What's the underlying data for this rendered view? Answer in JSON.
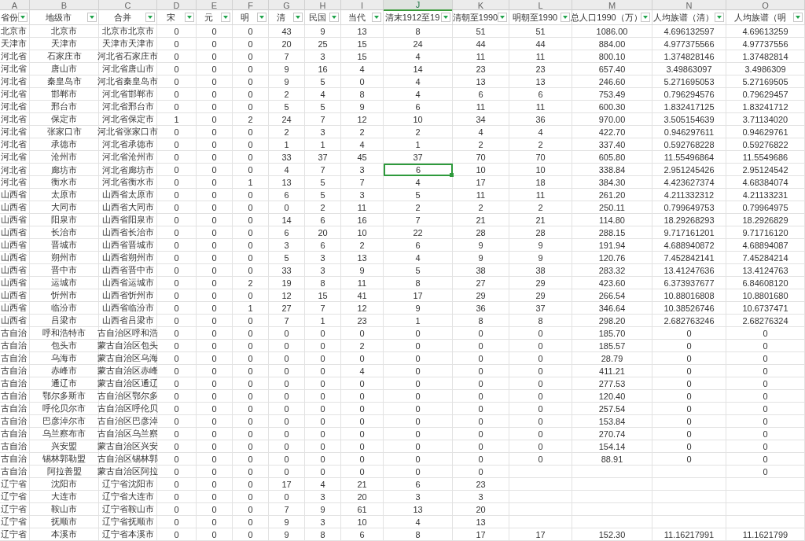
{
  "column_letters": [
    {
      "label": "A",
      "selected": false
    },
    {
      "label": "B",
      "selected": false
    },
    {
      "label": "C",
      "selected": false
    },
    {
      "label": "D",
      "selected": false
    },
    {
      "label": "E",
      "selected": false
    },
    {
      "label": "F",
      "selected": false
    },
    {
      "label": "G",
      "selected": false
    },
    {
      "label": "H",
      "selected": false
    },
    {
      "label": "I",
      "selected": false
    },
    {
      "label": "J",
      "selected": true
    },
    {
      "label": "K",
      "selected": false
    },
    {
      "label": "L",
      "selected": false
    },
    {
      "label": "M",
      "selected": false
    },
    {
      "label": "N",
      "selected": false
    },
    {
      "label": "O",
      "selected": false
    }
  ],
  "header": [
    "省份",
    "地级市",
    "合并",
    "宋",
    "元",
    "明",
    "清",
    "民国",
    "当代",
    "清末1912至19",
    "清朝至1990",
    "明朝至1990",
    "总人口1990（万）",
    "人均族谱（清）",
    "人均族谱（明"
  ],
  "rows": [
    {
      "selected": false,
      "cells": [
        "北京市",
        "北京市",
        "北京市北京市",
        "0",
        "0",
        "0",
        "43",
        "9",
        "13",
        "8",
        "51",
        "51",
        "1086.00",
        "4.696132597",
        "4.69613259"
      ]
    },
    {
      "selected": false,
      "cells": [
        "天津市",
        "天津市",
        "天津市天津市",
        "0",
        "0",
        "0",
        "20",
        "25",
        "15",
        "24",
        "44",
        "44",
        "884.00",
        "4.977375566",
        "4.97737556"
      ]
    },
    {
      "selected": false,
      "cells": [
        "河北省",
        "石家庄市",
        "河北省石家庄市",
        "0",
        "0",
        "0",
        "7",
        "3",
        "15",
        "4",
        "11",
        "11",
        "800.10",
        "1.374828146",
        "1.37482814"
      ]
    },
    {
      "selected": false,
      "cells": [
        "河北省",
        "唐山市",
        "河北省唐山市",
        "0",
        "0",
        "0",
        "9",
        "16",
        "4",
        "14",
        "23",
        "23",
        "657.40",
        "3.49863097",
        "3.4986309"
      ]
    },
    {
      "selected": false,
      "cells": [
        "河北省",
        "秦皇岛市",
        "河北省秦皇岛市",
        "0",
        "0",
        "0",
        "9",
        "5",
        "0",
        "4",
        "13",
        "13",
        "246.60",
        "5.271695053",
        "5.27169505"
      ]
    },
    {
      "selected": false,
      "cells": [
        "河北省",
        "邯郸市",
        "河北省邯郸市",
        "0",
        "0",
        "0",
        "2",
        "4",
        "8",
        "4",
        "6",
        "6",
        "753.49",
        "0.796294576",
        "0.79629457"
      ]
    },
    {
      "selected": false,
      "cells": [
        "河北省",
        "邢台市",
        "河北省邢台市",
        "0",
        "0",
        "0",
        "5",
        "5",
        "9",
        "6",
        "11",
        "11",
        "600.30",
        "1.832417125",
        "1.83241712"
      ]
    },
    {
      "selected": false,
      "cells": [
        "河北省",
        "保定市",
        "河北省保定市",
        "1",
        "0",
        "2",
        "24",
        "7",
        "12",
        "10",
        "34",
        "36",
        "970.00",
        "3.505154639",
        "3.71134020"
      ]
    },
    {
      "selected": false,
      "cells": [
        "河北省",
        "张家口市",
        "河北省张家口市",
        "0",
        "0",
        "0",
        "2",
        "3",
        "2",
        "2",
        "4",
        "4",
        "422.70",
        "0.946297611",
        "0.94629761"
      ]
    },
    {
      "selected": false,
      "cells": [
        "河北省",
        "承德市",
        "河北省承德市",
        "0",
        "0",
        "0",
        "1",
        "1",
        "4",
        "1",
        "2",
        "2",
        "337.40",
        "0.592768228",
        "0.59276822"
      ]
    },
    {
      "selected": false,
      "cells": [
        "河北省",
        "沧州市",
        "河北省沧州市",
        "0",
        "0",
        "0",
        "33",
        "37",
        "45",
        "37",
        "70",
        "70",
        "605.80",
        "11.55496864",
        "11.5549686"
      ]
    },
    {
      "selected": true,
      "cells": [
        "河北省",
        "廊坊市",
        "河北省廊坊市",
        "0",
        "0",
        "0",
        "4",
        "7",
        "3",
        "6",
        "10",
        "10",
        "338.84",
        "2.951245426",
        "2.95124542"
      ]
    },
    {
      "selected": false,
      "cells": [
        "河北省",
        "衡水市",
        "河北省衡水市",
        "0",
        "0",
        "1",
        "13",
        "5",
        "7",
        "4",
        "17",
        "18",
        "384.30",
        "4.423627374",
        "4.68384074"
      ]
    },
    {
      "selected": false,
      "cells": [
        "山西省",
        "太原市",
        "山西省太原市",
        "0",
        "0",
        "0",
        "6",
        "5",
        "3",
        "5",
        "11",
        "11",
        "261.20",
        "4.211332312",
        "4.21133231"
      ]
    },
    {
      "selected": false,
      "cells": [
        "山西省",
        "大同市",
        "山西省大同市",
        "0",
        "0",
        "0",
        "0",
        "2",
        "11",
        "2",
        "2",
        "2",
        "250.11",
        "0.799649753",
        "0.79964975"
      ]
    },
    {
      "selected": false,
      "cells": [
        "山西省",
        "阳泉市",
        "山西省阳泉市",
        "0",
        "0",
        "0",
        "14",
        "6",
        "16",
        "7",
        "21",
        "21",
        "114.80",
        "18.29268293",
        "18.2926829"
      ]
    },
    {
      "selected": false,
      "cells": [
        "山西省",
        "长治市",
        "山西省长治市",
        "0",
        "0",
        "0",
        "6",
        "20",
        "10",
        "22",
        "28",
        "28",
        "288.15",
        "9.717161201",
        "9.71716120"
      ]
    },
    {
      "selected": false,
      "cells": [
        "山西省",
        "晋城市",
        "山西省晋城市",
        "0",
        "0",
        "0",
        "3",
        "6",
        "2",
        "6",
        "9",
        "9",
        "191.94",
        "4.688940872",
        "4.68894087"
      ]
    },
    {
      "selected": false,
      "cells": [
        "山西省",
        "朔州市",
        "山西省朔州市",
        "0",
        "0",
        "0",
        "5",
        "3",
        "13",
        "4",
        "9",
        "9",
        "120.76",
        "7.452842141",
        "7.45284214"
      ]
    },
    {
      "selected": false,
      "cells": [
        "山西省",
        "晋中市",
        "山西省晋中市",
        "0",
        "0",
        "0",
        "33",
        "3",
        "9",
        "5",
        "38",
        "38",
        "283.32",
        "13.41247636",
        "13.4124763"
      ]
    },
    {
      "selected": false,
      "cells": [
        "山西省",
        "运城市",
        "山西省运城市",
        "0",
        "0",
        "2",
        "19",
        "8",
        "11",
        "8",
        "27",
        "29",
        "423.60",
        "6.373937677",
        "6.84608120"
      ]
    },
    {
      "selected": false,
      "cells": [
        "山西省",
        "忻州市",
        "山西省忻州市",
        "0",
        "0",
        "0",
        "12",
        "15",
        "41",
        "17",
        "29",
        "29",
        "266.54",
        "10.88016808",
        "10.8801680"
      ]
    },
    {
      "selected": false,
      "cells": [
        "山西省",
        "临汾市",
        "山西省临汾市",
        "0",
        "0",
        "1",
        "27",
        "7",
        "12",
        "9",
        "36",
        "37",
        "346.64",
        "10.38526746",
        "10.6737471"
      ]
    },
    {
      "selected": false,
      "cells": [
        "山西省",
        "吕梁市",
        "山西省吕梁市",
        "0",
        "0",
        "0",
        "7",
        "1",
        "23",
        "1",
        "8",
        "8",
        "298.20",
        "2.682763246",
        "2.68276324"
      ]
    },
    {
      "selected": false,
      "cells": [
        "古自治",
        "呼和浩特市",
        "古自治区呼和浩",
        "0",
        "0",
        "0",
        "0",
        "0",
        "0",
        "0",
        "0",
        "0",
        "185.70",
        "0",
        "0"
      ]
    },
    {
      "selected": false,
      "cells": [
        "古自治",
        "包头市",
        "蒙古自治区包头",
        "0",
        "0",
        "0",
        "0",
        "0",
        "2",
        "0",
        "0",
        "0",
        "185.57",
        "0",
        "0"
      ]
    },
    {
      "selected": false,
      "cells": [
        "古自治",
        "乌海市",
        "蒙古自治区乌海",
        "0",
        "0",
        "0",
        "0",
        "0",
        "0",
        "0",
        "0",
        "0",
        "28.79",
        "0",
        "0"
      ]
    },
    {
      "selected": false,
      "cells": [
        "古自治",
        "赤峰市",
        "蒙古自治区赤峰",
        "0",
        "0",
        "0",
        "0",
        "0",
        "4",
        "0",
        "0",
        "0",
        "411.21",
        "0",
        "0"
      ]
    },
    {
      "selected": false,
      "cells": [
        "古自治",
        "通辽市",
        "蒙古自治区通辽",
        "0",
        "0",
        "0",
        "0",
        "0",
        "0",
        "0",
        "0",
        "0",
        "277.53",
        "0",
        "0"
      ]
    },
    {
      "selected": false,
      "cells": [
        "古自治",
        "鄂尔多斯市",
        "古自治区鄂尔多",
        "0",
        "0",
        "0",
        "0",
        "0",
        "0",
        "0",
        "0",
        "0",
        "120.40",
        "0",
        "0"
      ]
    },
    {
      "selected": false,
      "cells": [
        "古自治",
        "呼伦贝尔市",
        "古自治区呼伦贝",
        "0",
        "0",
        "0",
        "0",
        "0",
        "0",
        "0",
        "0",
        "0",
        "257.54",
        "0",
        "0"
      ]
    },
    {
      "selected": false,
      "cells": [
        "古自治",
        "巴彦淖尔市",
        "古自治区巴彦淖",
        "0",
        "0",
        "0",
        "0",
        "0",
        "0",
        "0",
        "0",
        "0",
        "153.84",
        "0",
        "0"
      ]
    },
    {
      "selected": false,
      "cells": [
        "古自治",
        "乌兰察布市",
        "古自治区乌兰察",
        "0",
        "0",
        "0",
        "0",
        "0",
        "0",
        "0",
        "0",
        "0",
        "270.74",
        "0",
        "0"
      ]
    },
    {
      "selected": false,
      "cells": [
        "古自治",
        "兴安盟",
        "蒙古自治区兴安",
        "0",
        "0",
        "0",
        "0",
        "0",
        "0",
        "0",
        "0",
        "0",
        "154.14",
        "0",
        "0"
      ]
    },
    {
      "selected": false,
      "cells": [
        "古自治",
        "锡林郭勒盟",
        "古自治区锡林郭",
        "0",
        "0",
        "0",
        "0",
        "0",
        "0",
        "0",
        "0",
        "0",
        "88.91",
        "0",
        "0"
      ]
    },
    {
      "selected": false,
      "cells": [
        "古自治",
        "阿拉善盟",
        "蒙古自治区阿拉",
        "0",
        "0",
        "0",
        "0",
        "0",
        "0",
        "0",
        "0",
        null,
        null,
        null,
        "0"
      ]
    },
    {
      "selected": false,
      "cells": [
        "辽宁省",
        "沈阳市",
        "辽宁省沈阳市",
        "0",
        "0",
        "0",
        "17",
        "4",
        "21",
        "6",
        "23",
        null,
        null,
        null,
        null
      ]
    },
    {
      "selected": false,
      "cells": [
        "辽宁省",
        "大连市",
        "辽宁省大连市",
        "0",
        "0",
        "0",
        "0",
        "3",
        "20",
        "3",
        "3",
        null,
        null,
        null,
        null
      ]
    },
    {
      "selected": false,
      "cells": [
        "辽宁省",
        "鞍山市",
        "辽宁省鞍山市",
        "0",
        "0",
        "0",
        "7",
        "9",
        "61",
        "13",
        "20",
        null,
        null,
        null,
        null
      ]
    },
    {
      "selected": false,
      "cells": [
        "辽宁省",
        "抚顺市",
        "辽宁省抚顺市",
        "0",
        "0",
        "0",
        "9",
        "3",
        "10",
        "4",
        "13",
        null,
        null,
        null,
        null
      ]
    },
    {
      "selected": false,
      "cells": [
        "辽宁省",
        "本溪市",
        "辽宁省本溪市",
        "0",
        "0",
        "0",
        "9",
        "8",
        "6",
        "8",
        "17",
        "17",
        "152.30",
        "11.16217991",
        "11.1621799"
      ]
    }
  ]
}
